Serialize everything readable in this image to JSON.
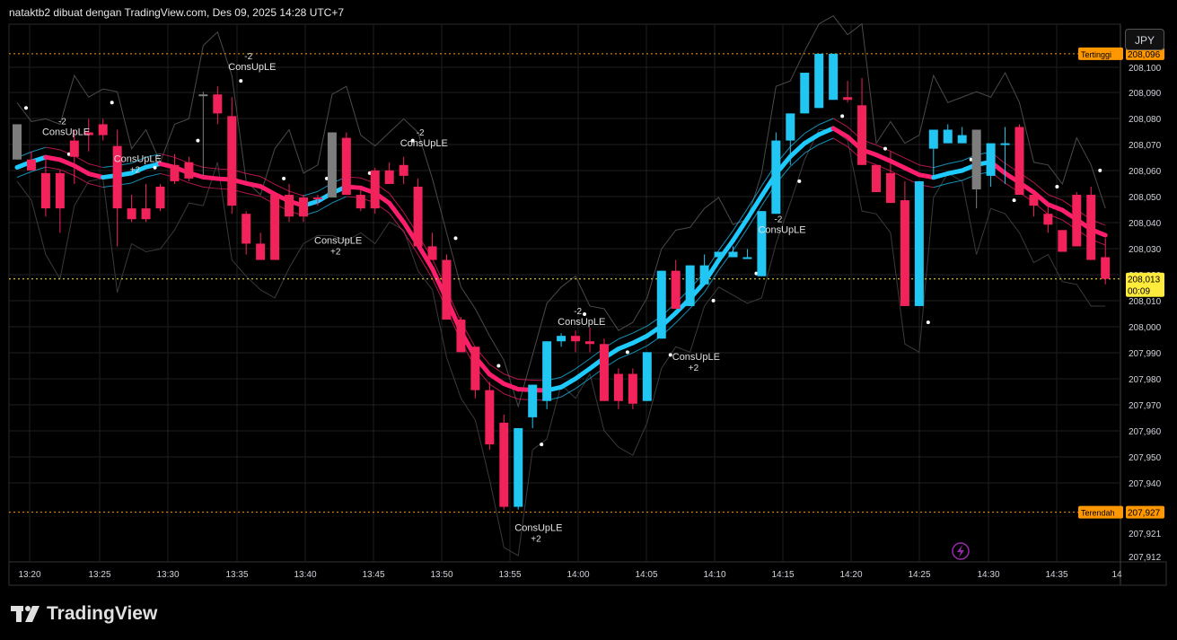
{
  "header": {
    "caption": "nataktb2 dibuat dengan TradingView.com, Des 09, 2025 14:28 UTC+7"
  },
  "currency_button": "JPY",
  "footer_brand": "TradingView",
  "colors": {
    "bull": "#21c6f3",
    "bear": "#f2225b",
    "neutral": "#7d7d7d",
    "band_pink": "#ff1e6e",
    "band_cyan": "#1ecbff",
    "level_line": "#ff9800",
    "price_tag": "#ffeb3b"
  },
  "chart_data": {
    "type": "candlestick",
    "x_ticks": [
      "13:20",
      "13:25",
      "13:30",
      "13:35",
      "13:40",
      "13:45",
      "13:50",
      "13:55",
      "14:00",
      "14:05",
      "14:10",
      "14:15",
      "14:20",
      "14:25",
      "14:30",
      "14:35",
      "14"
    ],
    "y_ticks": [
      "208,100",
      "208,090",
      "208,080",
      "208,070",
      "208,060",
      "208,050",
      "208,040",
      "208,030",
      "208,020",
      "208,010",
      "208,000",
      "207,990",
      "207,980",
      "207,970",
      "207,960",
      "207,950",
      "207,940",
      "207,930",
      "207,921",
      "207,912"
    ],
    "ylim": [
      207.912,
      208.1
    ],
    "levels": [
      {
        "label": "Tertinggi",
        "value": "208,096",
        "y": 208.096
      },
      {
        "label": "Terendah",
        "value": "207,927",
        "y": 207.927
      }
    ],
    "last_price": {
      "value": "208,013",
      "countdown": "00:09",
      "y": 208.013
    },
    "candles": [
      [
        208.057,
        208.07,
        208.057,
        208.07,
        "n"
      ],
      [
        208.057,
        208.06,
        208.053,
        208.053,
        "r"
      ],
      [
        208.052,
        208.058,
        208.036,
        208.039,
        "r"
      ],
      [
        208.039,
        208.053,
        208.03,
        208.052,
        "r"
      ],
      [
        208.058,
        208.068,
        208.048,
        208.064,
        "r"
      ],
      [
        208.066,
        208.072,
        208.06,
        208.067,
        "r"
      ],
      [
        208.07,
        208.072,
        208.064,
        208.066,
        "r"
      ],
      [
        208.062,
        208.068,
        208.025,
        208.039,
        "r"
      ],
      [
        208.039,
        208.044,
        208.034,
        208.035,
        "r"
      ],
      [
        208.035,
        208.048,
        208.034,
        208.039,
        "r"
      ],
      [
        208.039,
        208.048,
        208.038,
        208.047,
        "r"
      ],
      [
        208.049,
        208.059,
        208.048,
        208.055,
        "r"
      ],
      [
        208.056,
        208.058,
        208.049,
        208.05,
        "r"
      ],
      [
        208.081,
        208.082,
        208.051,
        208.081,
        "n"
      ],
      [
        208.081,
        208.084,
        208.07,
        208.074,
        "r"
      ],
      [
        208.073,
        208.08,
        208.037,
        208.04,
        "r"
      ],
      [
        208.037,
        208.038,
        208.022,
        208.026,
        "r"
      ],
      [
        208.026,
        208.03,
        208.02,
        208.02,
        "r"
      ],
      [
        208.02,
        208.044,
        208.02,
        208.044,
        "r"
      ],
      [
        208.044,
        208.048,
        208.034,
        208.036,
        "r"
      ],
      [
        208.036,
        208.044,
        208.034,
        208.043,
        "r"
      ],
      [
        208.043,
        208.044,
        208.04,
        208.043,
        "r"
      ],
      [
        208.043,
        208.067,
        208.043,
        208.067,
        "n"
      ],
      [
        208.065,
        208.067,
        208.044,
        208.044,
        "r"
      ],
      [
        208.044,
        208.046,
        208.038,
        208.039,
        "r"
      ],
      [
        208.039,
        208.054,
        208.037,
        208.053,
        "r"
      ],
      [
        208.053,
        208.056,
        208.048,
        208.048,
        "r"
      ],
      [
        208.051,
        208.058,
        208.048,
        208.055,
        "r"
      ],
      [
        208.047,
        208.05,
        208.024,
        208.025,
        "r"
      ],
      [
        208.025,
        208.03,
        208.02,
        208.02,
        "r"
      ],
      [
        208.02,
        208.022,
        207.998,
        207.998,
        "r"
      ],
      [
        207.998,
        207.999,
        207.986,
        207.986,
        "r"
      ],
      [
        207.988,
        207.988,
        207.969,
        207.972,
        "r"
      ],
      [
        207.972,
        207.975,
        207.95,
        207.952,
        "r"
      ],
      [
        207.96,
        207.963,
        207.928,
        207.929,
        "r"
      ],
      [
        207.929,
        207.958,
        207.928,
        207.958,
        "b"
      ],
      [
        207.962,
        207.974,
        207.958,
        207.974,
        "b"
      ],
      [
        207.968,
        207.99,
        207.965,
        207.99,
        "b"
      ],
      [
        207.99,
        207.993,
        207.988,
        207.992,
        "b"
      ],
      [
        207.992,
        207.994,
        207.986,
        207.99,
        "r"
      ],
      [
        207.99,
        207.995,
        207.986,
        207.989,
        "r"
      ],
      [
        207.989,
        207.991,
        207.968,
        207.968,
        "r"
      ],
      [
        207.978,
        207.98,
        207.965,
        207.968,
        "r"
      ],
      [
        207.978,
        207.98,
        207.965,
        207.967,
        "r"
      ],
      [
        207.968,
        207.986,
        207.968,
        207.986,
        "b"
      ],
      [
        207.991,
        208.016,
        207.991,
        208.016,
        "b"
      ],
      [
        208.016,
        208.02,
        208.002,
        208.002,
        "r"
      ],
      [
        208.003,
        208.018,
        208.003,
        208.018,
        "b"
      ],
      [
        208.011,
        208.022,
        208.011,
        208.018,
        "b"
      ],
      [
        208.021,
        208.023,
        208.021,
        208.023,
        "b"
      ],
      [
        208.021,
        208.025,
        208.021,
        208.023,
        "b"
      ],
      [
        208.021,
        208.024,
        208.021,
        208.021,
        "b"
      ],
      [
        208.014,
        208.038,
        208.014,
        208.038,
        "b"
      ],
      [
        208.037,
        208.067,
        208.037,
        208.064,
        "b"
      ],
      [
        208.064,
        208.066,
        208.055,
        208.074,
        "b"
      ],
      [
        208.074,
        208.089,
        208.074,
        208.089,
        "b"
      ],
      [
        208.096,
        208.096,
        208.076,
        208.076,
        "b"
      ],
      [
        208.096,
        208.096,
        208.079,
        208.079,
        "b"
      ],
      [
        208.079,
        208.086,
        208.078,
        208.08,
        "r"
      ],
      [
        208.077,
        208.087,
        208.055,
        208.055,
        "r"
      ],
      [
        208.055,
        208.055,
        208.045,
        208.045,
        "r"
      ],
      [
        208.052,
        208.06,
        208.041,
        208.041,
        "r"
      ],
      [
        208.042,
        208.049,
        208.003,
        208.003,
        "r"
      ],
      [
        208.003,
        208.049,
        208.003,
        208.049,
        "b"
      ],
      [
        208.061,
        208.068,
        208.051,
        208.068,
        "b"
      ],
      [
        208.068,
        208.07,
        208.063,
        208.063,
        "b"
      ],
      [
        208.063,
        208.069,
        208.063,
        208.066,
        "b"
      ],
      [
        208.046,
        208.068,
        208.039,
        208.068,
        "n"
      ],
      [
        208.051,
        208.063,
        208.047,
        208.063,
        "b"
      ],
      [
        208.063,
        208.069,
        208.048,
        208.063,
        "b"
      ],
      [
        208.069,
        208.07,
        208.044,
        208.044,
        "r"
      ],
      [
        208.044,
        208.045,
        208.036,
        208.04,
        "r"
      ],
      [
        208.037,
        208.041,
        208.03,
        208.033,
        "r"
      ],
      [
        208.031,
        208.031,
        208.023,
        208.023,
        "r"
      ],
      [
        208.044,
        208.045,
        208.025,
        208.025,
        "r"
      ],
      [
        208.044,
        208.047,
        208.02,
        208.02,
        "r"
      ],
      [
        208.021,
        208.028,
        208.011,
        208.013,
        "r"
      ]
    ]
  }
}
